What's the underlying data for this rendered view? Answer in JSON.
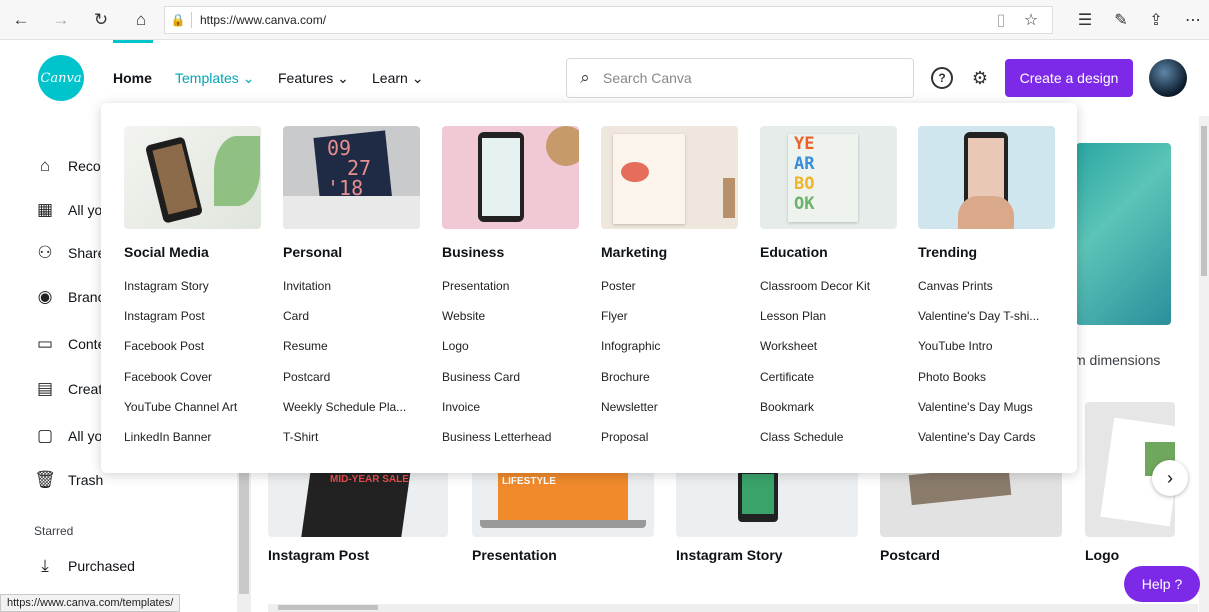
{
  "browser": {
    "url": "https://www.canva.com/",
    "status_url": "https://www.canva.com/templates/"
  },
  "header": {
    "logo_text": "Canva",
    "nav": {
      "home": "Home",
      "templates": "Templates ⌄",
      "features": "Features ⌄",
      "learn": "Learn ⌄"
    },
    "search_placeholder": "Search Canva",
    "help_icon": "?",
    "create_button": "Create a design"
  },
  "sidebar": {
    "items": [
      {
        "icon": "home-icon",
        "glyph": "⌂",
        "label": "Recor"
      },
      {
        "icon": "grid-icon",
        "glyph": "▦",
        "label": "All yo"
      },
      {
        "icon": "people-icon",
        "glyph": "⚇",
        "label": "Share"
      },
      {
        "icon": "brand-icon",
        "glyph": "◉",
        "label": "Branc"
      },
      {
        "icon": "calendar-icon",
        "glyph": "▭",
        "label": "Conte"
      },
      {
        "icon": "apps-icon",
        "glyph": "▤",
        "label": "Creat"
      },
      {
        "icon": "folder-icon",
        "glyph": "▢",
        "label": "All yo"
      },
      {
        "icon": "trash-icon",
        "glyph": "🗑",
        "label": "Trash"
      }
    ],
    "starred_heading": "Starred",
    "purchased_label": "Purchased"
  },
  "dropdown": {
    "columns": [
      {
        "heading": "Social Media",
        "links": [
          "Instagram Story",
          "Instagram Post",
          "Facebook Post",
          "Facebook Cover",
          "YouTube Channel Art",
          "LinkedIn Banner"
        ]
      },
      {
        "heading": "Personal",
        "links": [
          "Invitation",
          "Card",
          "Resume",
          "Postcard",
          "Weekly Schedule Pla...",
          "T-Shirt"
        ]
      },
      {
        "heading": "Business",
        "links": [
          "Presentation",
          "Website",
          "Logo",
          "Business Card",
          "Invoice",
          "Business Letterhead"
        ]
      },
      {
        "heading": "Marketing",
        "links": [
          "Poster",
          "Flyer",
          "Infographic",
          "Brochure",
          "Newsletter",
          "Proposal"
        ]
      },
      {
        "heading": "Education",
        "links": [
          "Classroom Decor Kit",
          "Lesson Plan",
          "Worksheet",
          "Certificate",
          "Bookmark",
          "Class Schedule"
        ]
      },
      {
        "heading": "Trending",
        "links": [
          "Canvas Prints",
          "Valentine's Day T-shi...",
          "YouTube Intro",
          "Photo Books",
          "Valentine's Day Mugs",
          "Valentine's Day Cards"
        ]
      }
    ],
    "personal_thumb_text": [
      "09",
      "27",
      "'18"
    ],
    "education_thumb_text": [
      "YE",
      "AR",
      "BO",
      "OK"
    ]
  },
  "main": {
    "custom_dimensions_label": "m dimensions",
    "cards": [
      "Instagram Post",
      "Presentation",
      "Instagram Story",
      "Postcard",
      "Logo"
    ],
    "card_overlay_texts": [
      "MID-YEAR SALE",
      "LIFESTYLE"
    ],
    "next_arrow": "›",
    "help_button": "Help ?"
  }
}
